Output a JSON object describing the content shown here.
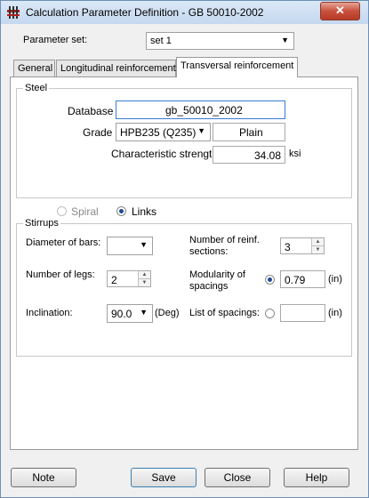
{
  "window": {
    "title": "Calculation Parameter Definition - GB 50010-2002",
    "close": "✕"
  },
  "parameter_set": {
    "label": "Parameter set:",
    "value": "set 1"
  },
  "tabs": [
    {
      "label": "General"
    },
    {
      "label": "Longitudinal reinforcement"
    },
    {
      "label": "Transversal reinforcement"
    }
  ],
  "steel": {
    "legend": "Steel",
    "database_label": "Database",
    "database_value": "gb_50010_2002",
    "grade_label": "Grade",
    "grade_value": "HPB235 (Q235)",
    "surface_value": "Plain",
    "strength_label": "Characteristic strength",
    "strength_value": "34.08",
    "strength_unit": "ksi"
  },
  "type": {
    "spiral_label": "Spiral",
    "links_label": "Links",
    "selected": "Links"
  },
  "stirrups": {
    "legend": "Stirrups",
    "diameter_label": "Diameter of bars:",
    "diameter_value": "",
    "sections_label_1": "Number of reinf.",
    "sections_label_2": "sections:",
    "sections_value": "3",
    "legs_label": "Number of legs:",
    "legs_value": "2",
    "modularity_label_1": "Modularity of",
    "modularity_label_2": "spacings",
    "modularity_value": "0.79",
    "modularity_unit": "(in)",
    "inclination_label": "Inclination:",
    "inclination_value": "90.0",
    "inclination_unit": "(Deg)",
    "spacings_list_label": "List of spacings:",
    "spacings_list_value": "",
    "spacings_list_unit": "(in)",
    "spacing_mode_selected": "Modularity of spacings"
  },
  "buttons": {
    "note": "Note",
    "save": "Save",
    "close": "Close",
    "help": "Help"
  }
}
